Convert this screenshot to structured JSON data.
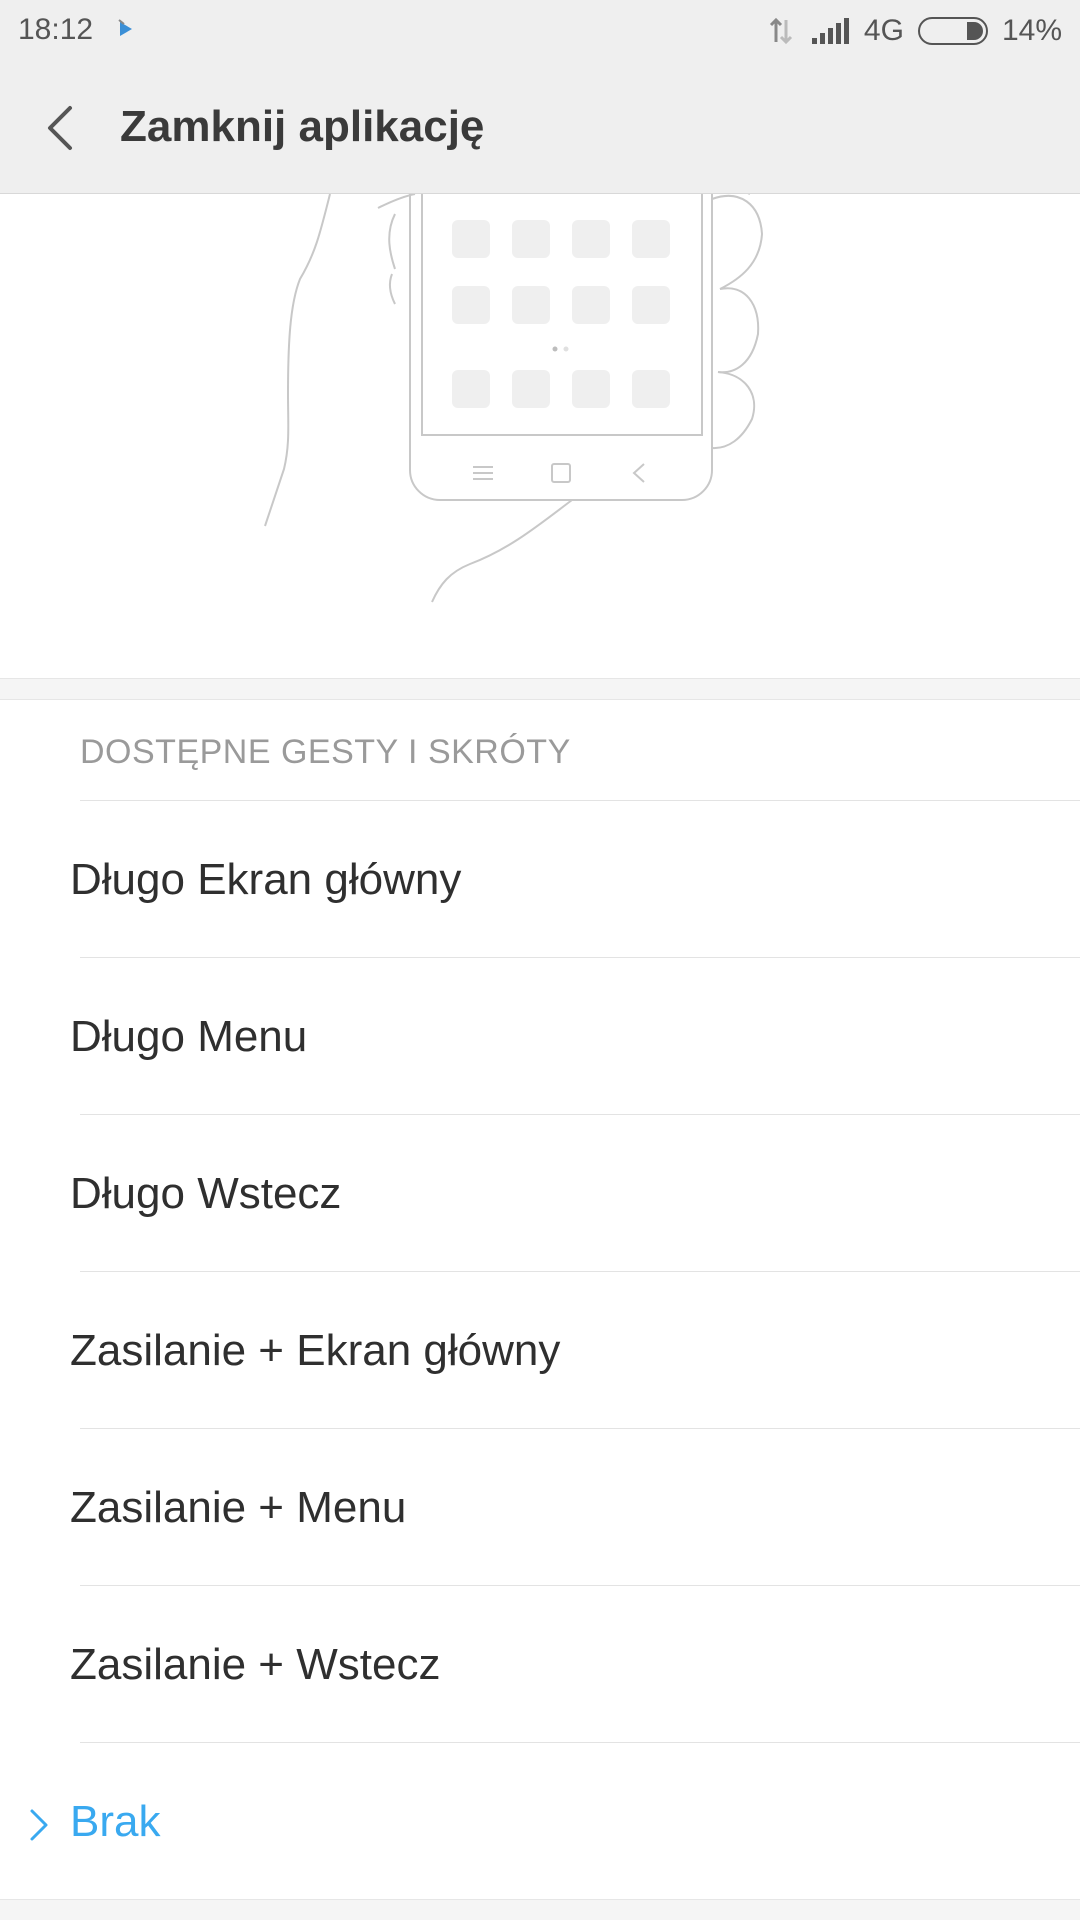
{
  "status_bar": {
    "time": "18:12",
    "network": "4G",
    "battery": "14%",
    "battery_level": 0.14
  },
  "app_bar": {
    "title": "Zamknij aplikację"
  },
  "section": {
    "header": "DOSTĘPNE GESTY I SKRÓTY"
  },
  "options": [
    {
      "label": "Długo Ekran główny",
      "selected": false
    },
    {
      "label": "Długo Menu",
      "selected": false
    },
    {
      "label": "Długo Wstecz",
      "selected": false
    },
    {
      "label": "Zasilanie + Ekran główny",
      "selected": false
    },
    {
      "label": "Zasilanie + Menu",
      "selected": false
    },
    {
      "label": "Zasilanie + Wstecz",
      "selected": false
    },
    {
      "label": "Brak",
      "selected": true
    }
  ],
  "colors": {
    "accent": "#39a9f0",
    "bar_background": "#efefef",
    "text_primary": "#2f2f2f",
    "text_secondary": "#9a9a9a"
  },
  "icons": {
    "back": "chevron-left-icon",
    "selected_marker": "chevron-right-icon",
    "signal": "signal-bars-icon",
    "data_transfer": "data-arrows-icon",
    "battery": "battery-icon"
  }
}
